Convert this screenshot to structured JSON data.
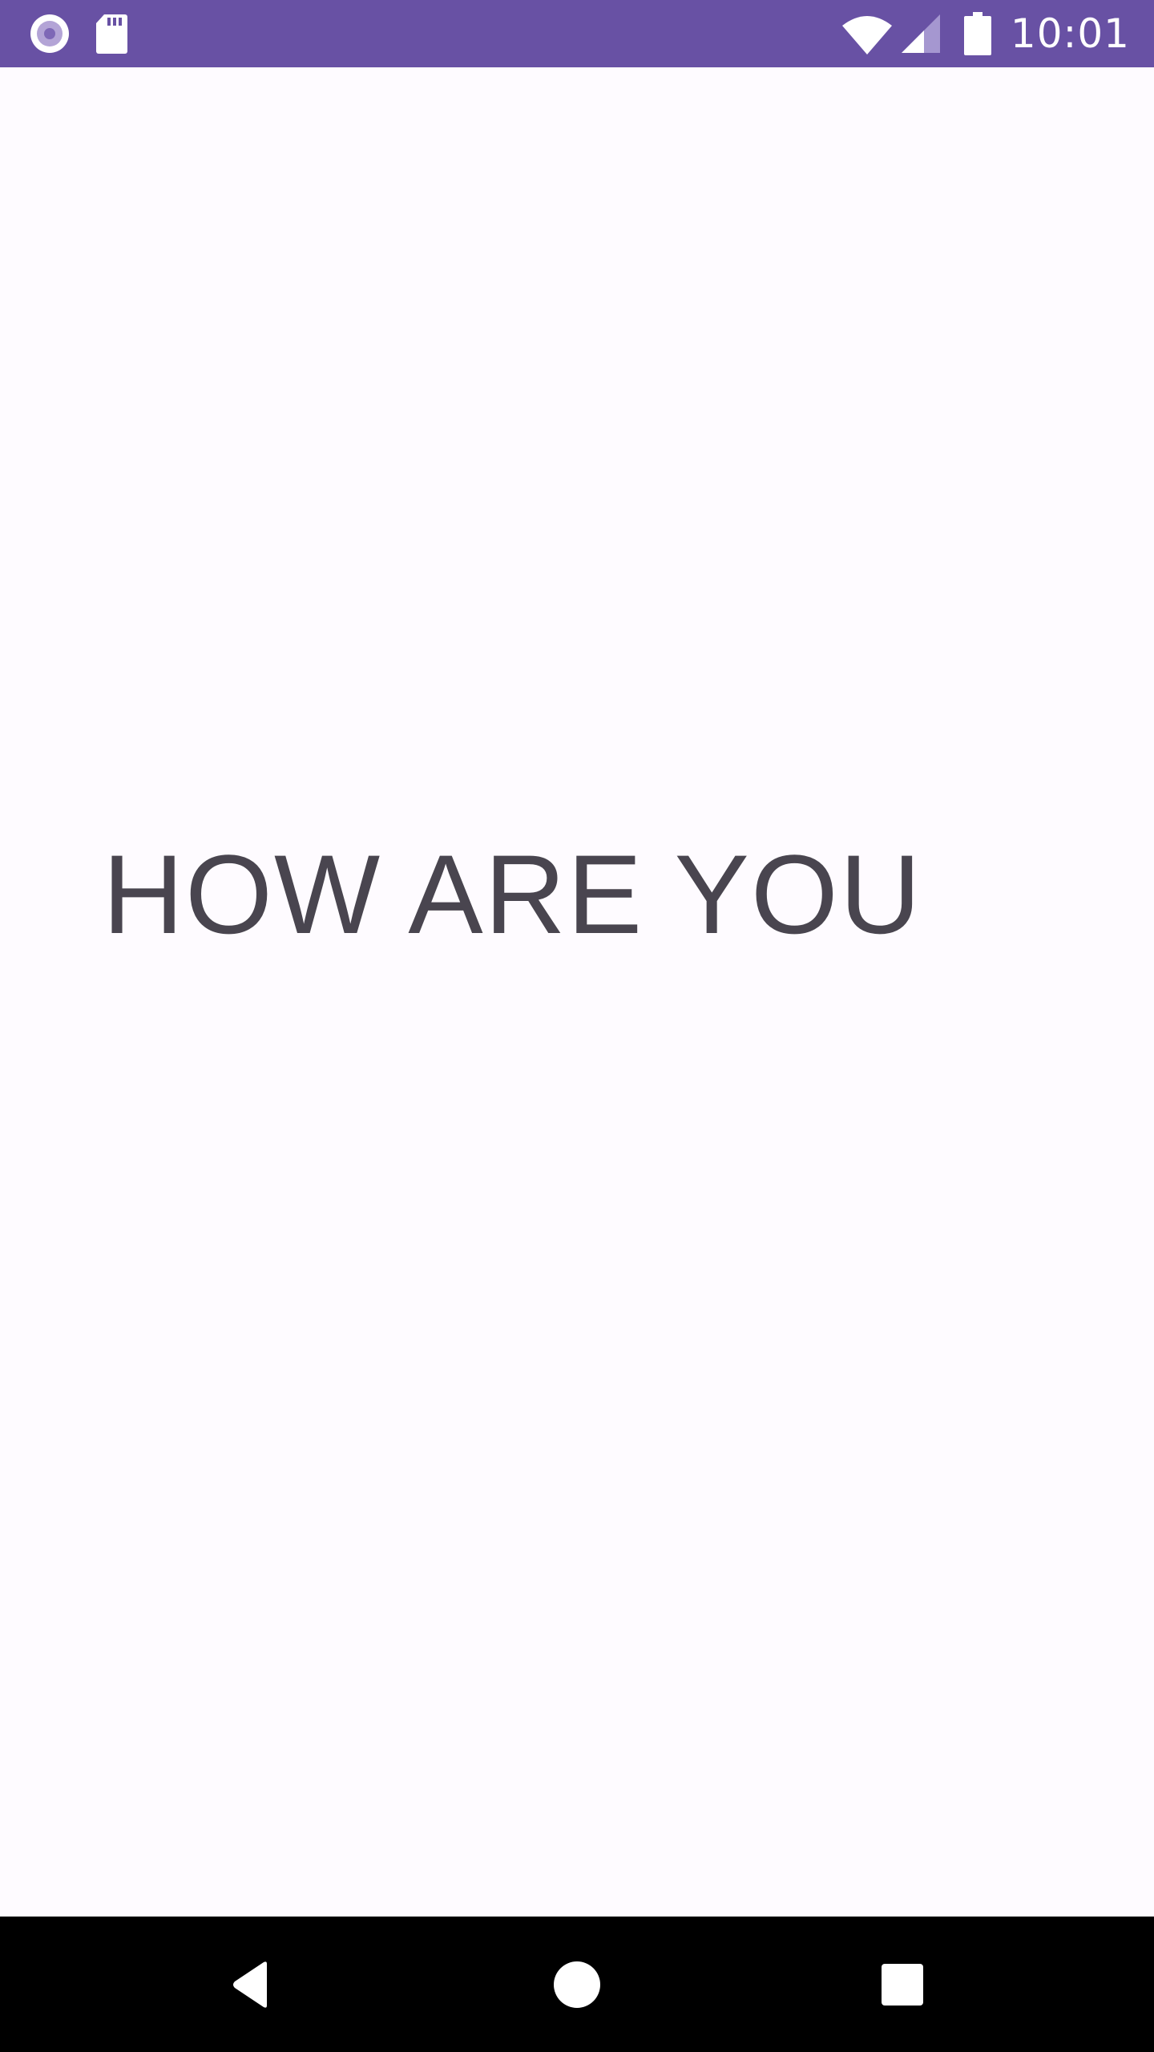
{
  "status_bar": {
    "time": "10:01",
    "background_color": "#6851A4",
    "left_icons": [
      "record-icon",
      "sd-card-icon"
    ],
    "right_icons": [
      "wifi-icon",
      "cell-signal-icon",
      "battery-icon"
    ]
  },
  "main": {
    "greeting_text": "HOW ARE YOU",
    "text_color": "#49454F",
    "background_color": "#FEFBFF"
  },
  "nav_bar": {
    "background_color": "#000000",
    "buttons": [
      "back-icon",
      "home-icon",
      "recents-icon"
    ]
  }
}
